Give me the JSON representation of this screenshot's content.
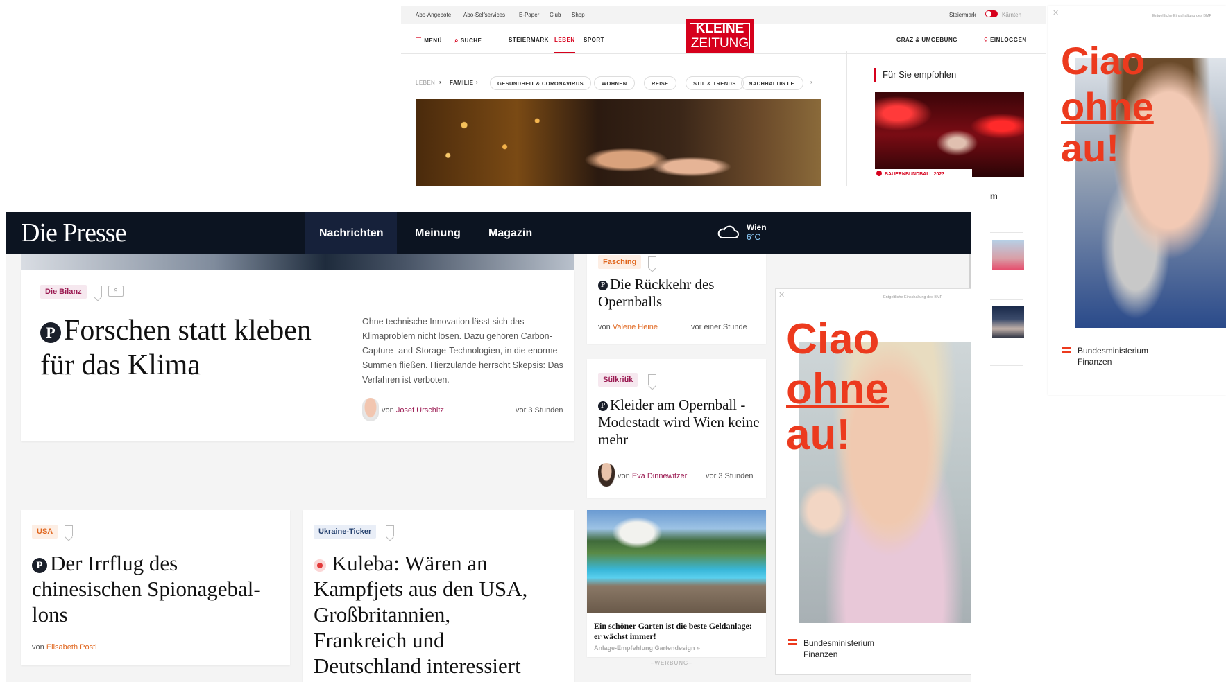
{
  "kleine": {
    "top_links": [
      "Abo-Angebote",
      "Abo-Selfservices",
      "E-Paper",
      "Club",
      "Shop"
    ],
    "region_left": "Steiermark",
    "region_right": "Kärnten",
    "nav": {
      "menu": "MENÜ",
      "search": "SUCHE",
      "steiermark": "STEIERMARK",
      "leben": "LEBEN",
      "sport": "SPORT",
      "graz": "GRAZ & UMGEBUNG",
      "login": "EINLOGGEN"
    },
    "logo_top": "KLEINE",
    "logo_bottom": "ZEITUNG",
    "breadcrumb": {
      "leben": "LEBEN",
      "familie": "FAMILIE"
    },
    "chips": [
      "GESUNDHEIT & CORONAVIRUS",
      "WOHNEN",
      "REISE",
      "STIL & TRENDS",
      "NACHHALTIG LE"
    ],
    "recommend_title": "Für Sie empfohlen",
    "recommend_tag": "BAUERNBUNDBALL 2023",
    "side_letter": "m"
  },
  "ad": {
    "disclaimer": "Entgeltliche Einschaltung des BMF",
    "line1": "Ciao",
    "line2": "ohne",
    "line3": "au!",
    "ministry_line1": "Bundesministerium",
    "ministry_line2": "Finanzen"
  },
  "presse": {
    "brand": "Die Presse",
    "nav": [
      "Nachrichten",
      "Meinung",
      "Magazin"
    ],
    "weather": {
      "city": "Wien",
      "temp": "6°C"
    },
    "main": {
      "tag": "Die Bilanz",
      "comments": "9",
      "title_line1": "Forschen statt kleben",
      "title_line2": "für das Klima",
      "teaser": "Ohne technische Innovation lässt sich das Klimaproblem nicht lösen. Dazu gehören Carbon-Capture- and-Storage-Technologien, in die enorme Summen fließen. Hierzulande herrscht Skepsis: Das Verfahren ist verboten.",
      "by": "von",
      "author": "Josef Urschitz",
      "time": "vor 3 Stunden"
    },
    "side1": {
      "tag": "Fasching",
      "title": "Die Rückkehr des Opernballs",
      "by": "von",
      "author": "Valerie Heine",
      "time": "vor einer Stunde"
    },
    "side2": {
      "tag": "Stilkritik",
      "title": "Kleider am Opernball - Modestadt wird Wien keine mehr",
      "by": "von",
      "author": "Eva Dinnewitzer",
      "time": "vor 3 Stunden"
    },
    "usa": {
      "tag": "USA",
      "title": "Der Irrflug des chinesischen Spionageballons",
      "title_l1": "Der Irrflug des",
      "title_l2": "chinesischen Spionagebal-",
      "title_l3": "lons",
      "by": "von",
      "author": "Elisabeth Postl"
    },
    "ukraine": {
      "tag": "Ukraine-Ticker",
      "title_l1": "Kuleba: Wären an",
      "title_l2": "Kampfjets aus den USA,",
      "title_l3": "Großbritannien,",
      "title_l4": "Frankreich und",
      "title_l5": "Deutschland interessiert"
    },
    "promo": {
      "title": "Ein schöner Garten ist die beste Geldanlage: er wächst immer!",
      "source": "Anlage-Empfehlung Gartendesign »",
      "label": "–WERBUNG–"
    }
  }
}
